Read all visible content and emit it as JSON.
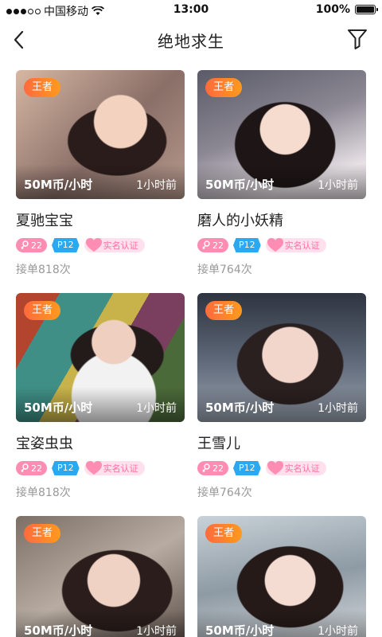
{
  "status_bar": {
    "carrier": "中国移动",
    "time": "13:00",
    "battery": "100%"
  },
  "nav": {
    "title": "绝地求生",
    "back_icon": "chevron-left-icon",
    "filter_icon": "funnel-filter-icon"
  },
  "colors": {
    "badge_start": "#ff6a3d",
    "badge_end": "#ff9a1e",
    "age_tag": "#ff8cb2",
    "level_tag": "#2aa8f2",
    "verify_bg": "#ffe0ec",
    "verify_text": "#ff6fa0"
  },
  "cards": [
    {
      "rank": "王者",
      "price": "50M币/小时",
      "time": "1小时前",
      "name": "夏驰宝宝",
      "age": "22",
      "level": "P12",
      "verify": "实名认证",
      "orders": "接单818次"
    },
    {
      "rank": "王者",
      "price": "50M币/小时",
      "time": "1小时前",
      "name": "磨人的小妖精",
      "age": "22",
      "level": "P12",
      "verify": "实名认证",
      "orders": "接单764次"
    },
    {
      "rank": "王者",
      "price": "50M币/小时",
      "time": "1小时前",
      "name": "宝姿虫虫",
      "age": "22",
      "level": "P12",
      "verify": "实名认证",
      "orders": "接单818次"
    },
    {
      "rank": "王者",
      "price": "50M币/小时",
      "time": "1小时前",
      "name": "王雪儿",
      "age": "22",
      "level": "P12",
      "verify": "实名认证",
      "orders": "接单764次"
    },
    {
      "rank": "王者",
      "price": "50M币/小时",
      "time": "1小时前",
      "name": "",
      "age": "",
      "level": "",
      "verify": "",
      "orders": ""
    },
    {
      "rank": "王者",
      "price": "50M币/小时",
      "time": "1小时前",
      "name": "",
      "age": "",
      "level": "",
      "verify": "",
      "orders": ""
    }
  ]
}
